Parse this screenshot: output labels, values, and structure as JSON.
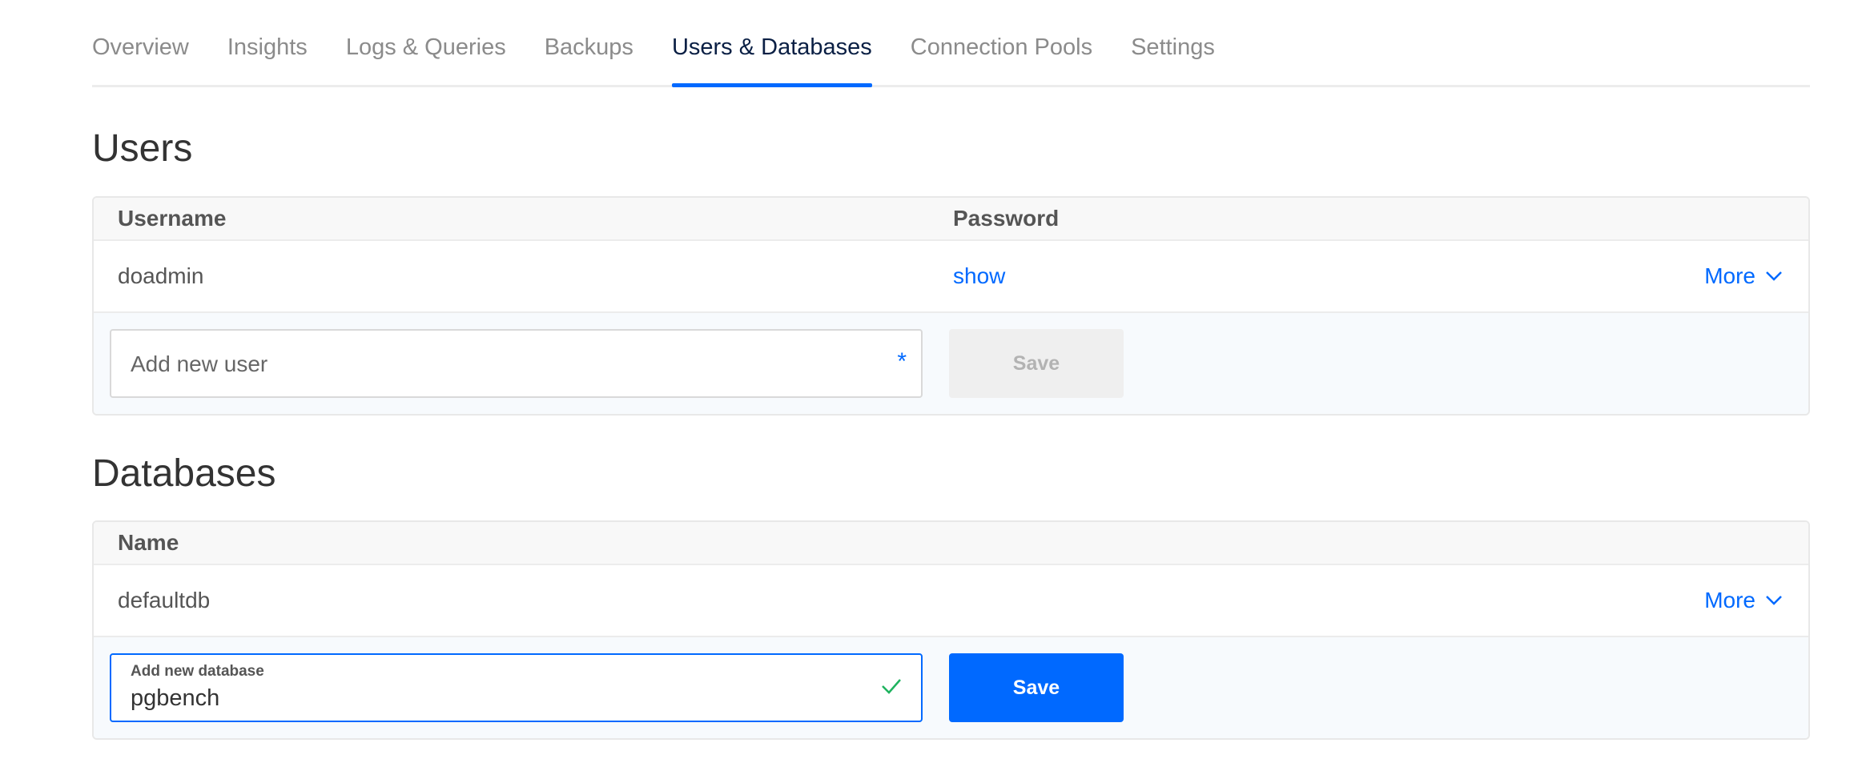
{
  "tabs": [
    {
      "label": "Overview",
      "active": false
    },
    {
      "label": "Insights",
      "active": false
    },
    {
      "label": "Logs & Queries",
      "active": false
    },
    {
      "label": "Backups",
      "active": false
    },
    {
      "label": "Users & Databases",
      "active": true
    },
    {
      "label": "Connection Pools",
      "active": false
    },
    {
      "label": "Settings",
      "active": false
    }
  ],
  "users": {
    "title": "Users",
    "columns": {
      "username": "Username",
      "password": "Password"
    },
    "rows": [
      {
        "username": "doadmin",
        "password_action": "show",
        "more": "More"
      }
    ],
    "add": {
      "placeholder": "Add new user",
      "required_mark": "*",
      "save_label": "Save"
    }
  },
  "databases": {
    "title": "Databases",
    "columns": {
      "name": "Name"
    },
    "rows": [
      {
        "name": "defaultdb",
        "more": "More"
      }
    ],
    "add": {
      "label": "Add new database",
      "value": "pgbench",
      "save_label": "Save"
    }
  },
  "colors": {
    "accent": "#0069ff",
    "active_tab_text": "#0a1f44",
    "valid_check": "#1fb35f",
    "disabled_button_bg": "#efefef"
  },
  "icons": {
    "more_chevron": "chevron-down-icon",
    "valid": "check-icon"
  }
}
